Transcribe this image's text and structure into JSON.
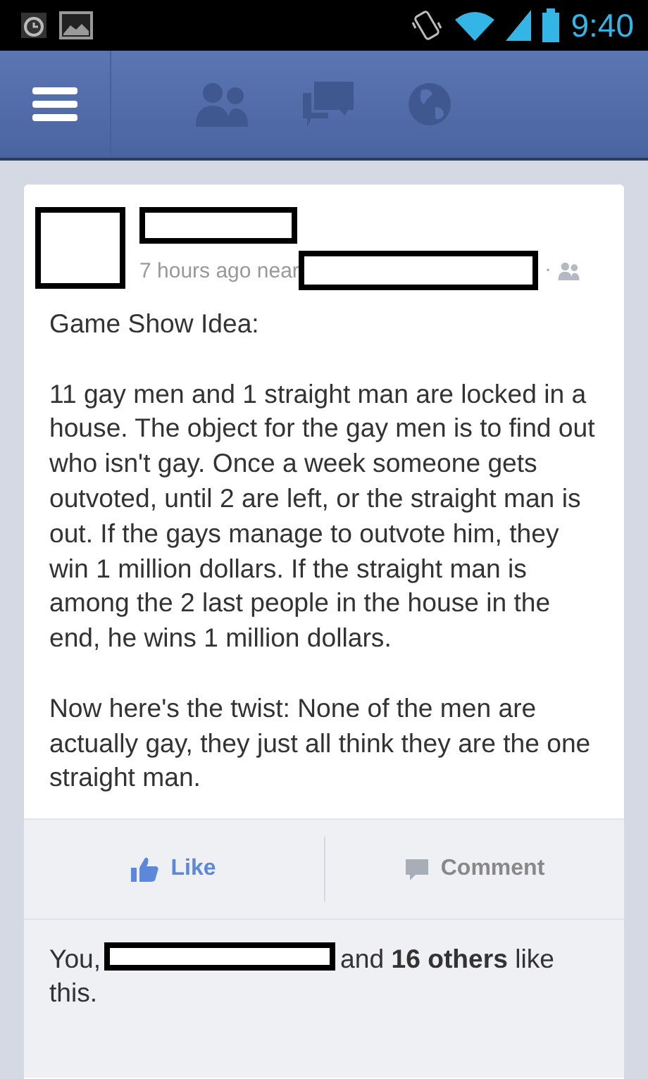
{
  "status_bar": {
    "time": "9:40"
  },
  "post": {
    "timestamp": "7 hours ago near",
    "separator": "·",
    "paragraphs": [
      "Game Show Idea:",
      "11 gay men and 1 straight man are locked in a house. The object for the gay men is to find out who isn't gay. Once a week someone gets outvoted, until 2 are left, or the straight man is out. If the gays manage to outvote him, they win 1 million dollars. If the straight man is among the 2 last people in the house in the end, he wins 1 million dollars.",
      "Now here's the twist: None of the men are actually gay, they just all think they are the one straight man."
    ],
    "actions": [
      {
        "kind": "like",
        "label": "Like",
        "active": true
      },
      {
        "kind": "comment",
        "label": "Comment",
        "active": false
      }
    ],
    "likes": {
      "prefix": "You,",
      "suffix": "and **16 others** like this."
    }
  }
}
